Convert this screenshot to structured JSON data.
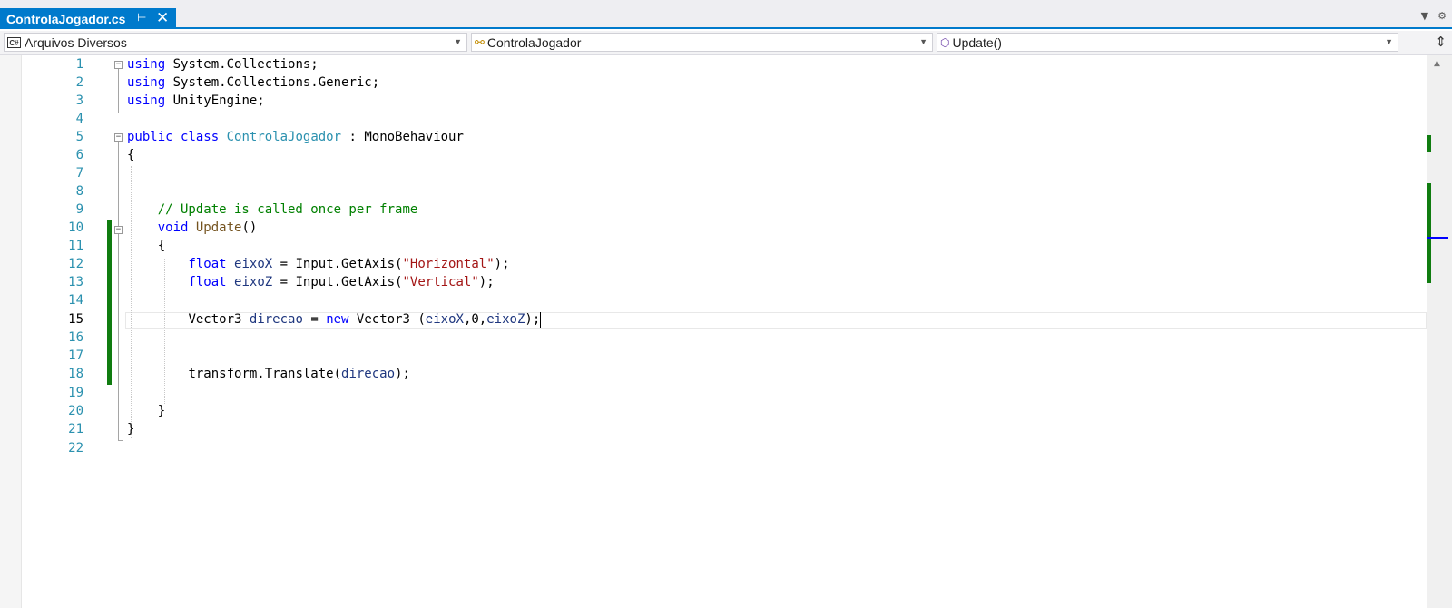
{
  "tab": {
    "title": "ControlaJogador.cs",
    "pin_icon": "pin-icon",
    "close_icon": "close-icon"
  },
  "navbar": {
    "project": "Arquivos Diversos",
    "class": "ControlaJogador",
    "member": "Update()"
  },
  "editor": {
    "line_numbers": [
      "1",
      "2",
      "3",
      "4",
      "5",
      "6",
      "7",
      "8",
      "9",
      "10",
      "11",
      "12",
      "13",
      "14",
      "15",
      "16",
      "17",
      "18",
      "19",
      "20",
      "21",
      "22"
    ],
    "current_line": 15,
    "code": {
      "l1_kw": "using",
      "l1_rest": " System.Collections;",
      "l2_kw": "using",
      "l2_rest": " System.Collections.Generic;",
      "l3_kw": "using",
      "l3_rest": " UnityEngine;",
      "l5_kw1": "public",
      "l5_kw2": "class",
      "l5_type": "ControlaJogador",
      "l5_rest": " : MonoBehaviour",
      "l6": "{",
      "l9_comment": "// Update is called once per frame",
      "l10_kw": "void",
      "l10_fn": "Update",
      "l10_rest": "()",
      "l11": "{",
      "l12_kw": "float",
      "l12_var": "eixoX",
      "l12_mid": " = Input.GetAxis(",
      "l12_str": "\"Horizontal\"",
      "l12_end": ");",
      "l13_kw": "float",
      "l13_var": "eixoZ",
      "l13_mid": " = Input.GetAxis(",
      "l13_str": "\"Vertical\"",
      "l13_end": ");",
      "l15_type": "Vector3",
      "l15_var": "direcao",
      "l15_eq": " = ",
      "l15_kw": "new",
      "l15_type2": " Vector3 (",
      "l15_a1": "eixoX",
      "l15_mid": ",0,",
      "l15_a2": "eixoZ",
      "l15_end": ");",
      "l18_a": "transform.Translate(",
      "l18_var": "direcao",
      "l18_end": ");",
      "l20": "}",
      "l21": "}"
    }
  },
  "colors": {
    "accent": "#007acc",
    "keyword": "#0000ff",
    "type": "#2b91af",
    "string": "#a31515",
    "comment": "#008000",
    "change_marker": "#107c10"
  }
}
